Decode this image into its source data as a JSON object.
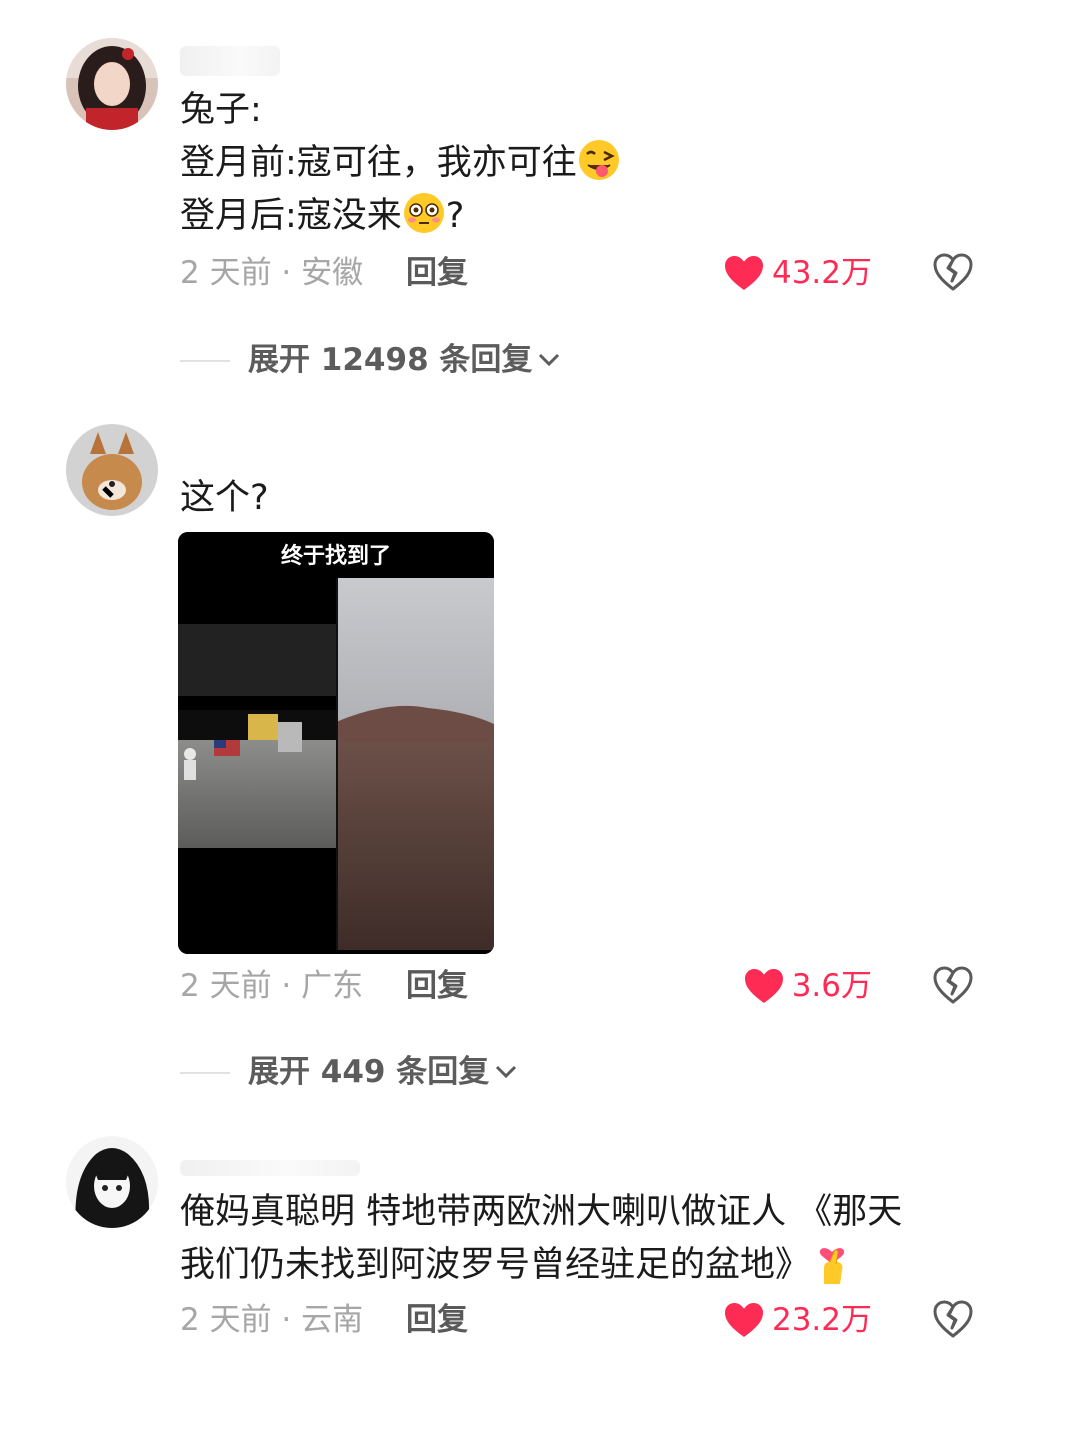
{
  "comments": [
    {
      "lines": [
        "兔子:",
        "登月前:寇可往，我亦可往",
        "登月后:寇没来",
        "?"
      ],
      "emojis": [
        "tongue-wink-emoji",
        "flushed-emoji"
      ],
      "time_location": "2 天前 · 安徽",
      "reply": "回复",
      "likes": "43.2万",
      "expand": "展开 12498 条回复"
    },
    {
      "lines": [
        "这个?"
      ],
      "media_caption": "终于找到了",
      "time_location": "2 天前 · 广东",
      "reply": "回复",
      "likes": "3.6万",
      "expand": "展开 449 条回复"
    },
    {
      "lines": [
        "俺妈真聪明 特地带两欧洲大喇叭做证人 《那天",
        "我们仍未找到阿波罗号曾经驻足的盆地》"
      ],
      "emojis": [
        "finger-heart-emoji"
      ],
      "time_location": "2 天前 · 云南",
      "reply": "回复",
      "likes": "23.2万"
    }
  ],
  "colors": {
    "like": "#fe2c55",
    "meta": "#a6a6a6",
    "reply": "#5a5a5a"
  },
  "icons": [
    "heart-icon",
    "broken-heart-icon",
    "chevron-down-icon"
  ]
}
